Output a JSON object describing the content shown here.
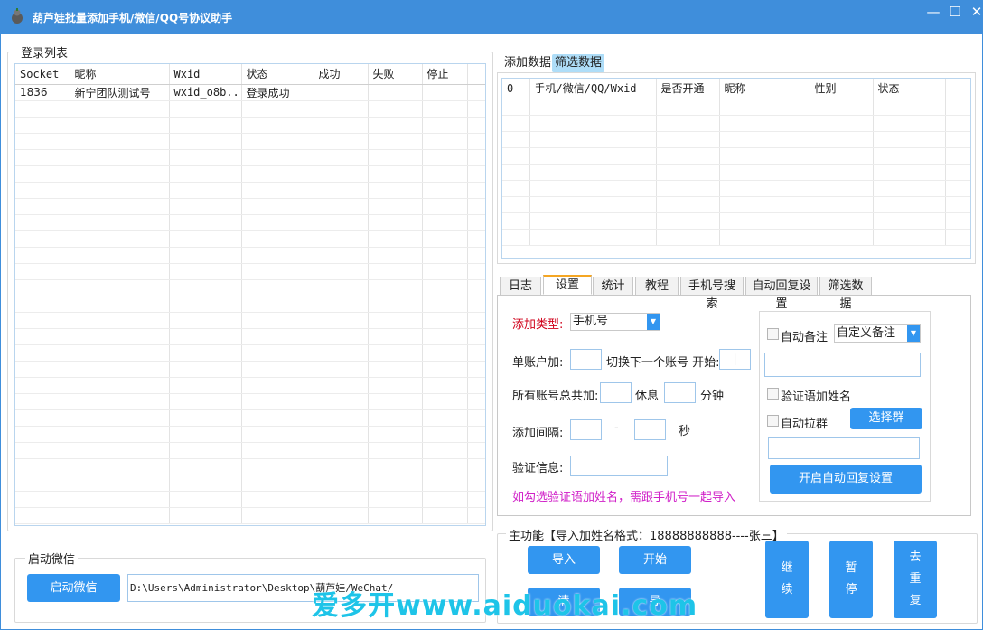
{
  "window": {
    "title": "葫芦娃批量添加手机/微信/QQ号协议助手",
    "min": "—",
    "max": "☐",
    "close": "✕"
  },
  "login_list": {
    "group_label": "登录列表",
    "columns": [
      "Socket",
      "昵称",
      "Wxid",
      "状态",
      "成功",
      "失败",
      "停止"
    ],
    "rows": [
      [
        "1836",
        "新宁团队测试号",
        "wxid_o8b...",
        "登录成功",
        "",
        "",
        ""
      ]
    ]
  },
  "start_wechat": {
    "group_label": "启动微信",
    "button": "启动微信",
    "path": "D:\\Users\\Administrator\\Desktop\\葫芦娃/WeChat/"
  },
  "data_tabs": {
    "tabs": [
      "添加数据",
      "筛选数据"
    ],
    "active": 1
  },
  "data_table": {
    "columns": [
      "0",
      "手机/微信/QQ/Wxid",
      "是否开通",
      "昵称",
      "性别",
      "状态"
    ]
  },
  "main_tabs": {
    "tabs": [
      "日志",
      "设置",
      "统计",
      "教程",
      "手机号搜索",
      "自动回复设置",
      "筛选数据"
    ],
    "active": 1
  },
  "settings": {
    "add_type_label": "添加类型:",
    "add_type_value": "手机号",
    "single_account_label": "单账户加:",
    "switch_label": "切换下一个账号 开始:",
    "switch_value": "|",
    "total_label": "所有账号总共加:",
    "rest_label": "休息",
    "minutes_label": "分钟",
    "interval_label": "添加间隔:",
    "dash": "-",
    "seconds_label": "秒",
    "verify_label": "验证信息:",
    "hint": "如勾选验证语加姓名，需跟手机号一起导入",
    "auto_remark_label": "自动备注",
    "remark_select": "自定义备注",
    "verify_name_label": "验证语加姓名",
    "auto_pull_label": "自动拉群",
    "choose_group_button": "选择群",
    "auto_reply_button": "开启自动回复设置"
  },
  "main_function": {
    "label": "主功能【导入加姓名格式：18888888888----张三】",
    "import": "导入",
    "start": "开始",
    "btn3": "清",
    "btn4": "导",
    "continue": [
      "继",
      "续"
    ],
    "pause": [
      "暂",
      "停"
    ],
    "dedupe": [
      "去",
      "重",
      "复"
    ]
  },
  "watermark": "爱多开www.aiduokai.com",
  "colors": {
    "titlebar": "#3f8edb",
    "button": "#3296f0",
    "hint": "#d020c8",
    "required": "#d0021b",
    "active_tab": "#f5a623"
  }
}
